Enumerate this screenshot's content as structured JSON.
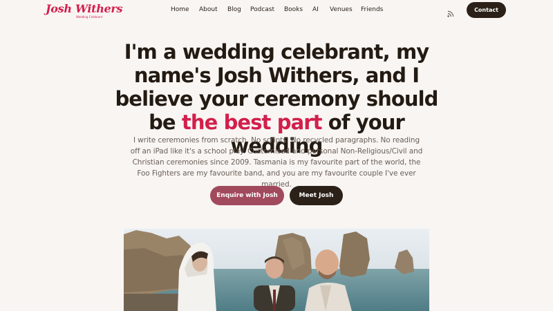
{
  "brand": {
    "name": "Josh Withers",
    "tagline": "Wedding Celebrant",
    "accent_color": "#d21f4b"
  },
  "nav": {
    "links": [
      {
        "label": "Home"
      },
      {
        "label": "About"
      },
      {
        "label": "Blog"
      },
      {
        "label": "Podcast"
      },
      {
        "label": "Books"
      },
      {
        "label": "AI"
      },
      {
        "label": "Venues"
      },
      {
        "label": "Friends"
      }
    ],
    "rss_icon": "rss-icon",
    "contact_label": "Contact"
  },
  "hero": {
    "headline_lines": [
      "I'm a wedding celebrant, my",
      "name's Josh Withers, and I",
      "believe your ceremony should"
    ],
    "headline_last_before": "be ",
    "headline_accent": "the best part",
    "headline_last_after": " of your wedding",
    "intro": "I write ceremonies from scratch. No scripts. No recycled paragraphs. No reading off an iPad like it's a school play. Customised and personal Non-Religious/Civil and Christian ceremonies since 2009. Tasmania is my favourite part of the world, the Foo Fighters are my favourite band, and you are my favourite couple I've ever married.",
    "enquire_label": "Enquire with Josh",
    "meet_label": "Meet Josh",
    "enquire_color": "#a24a5d",
    "dark_color": "#2b2118"
  }
}
